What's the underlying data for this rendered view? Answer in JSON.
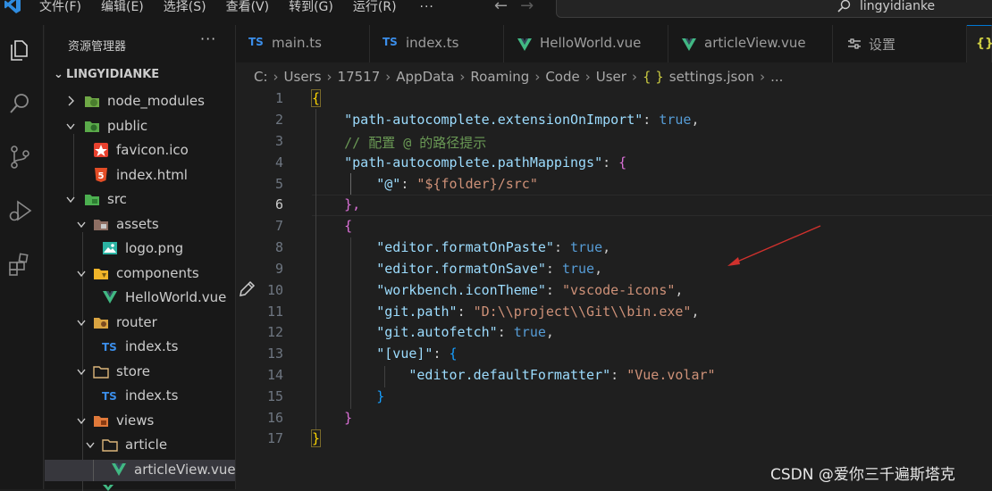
{
  "menu": [
    "文件(F)",
    "编辑(E)",
    "选择(S)",
    "查看(V)",
    "转到(G)",
    "运行(R)"
  ],
  "menu_more": "···",
  "search_text": "lingyidianke",
  "sidebar": {
    "title": "资源管理器",
    "more": "···",
    "project": "LINGYIDIANKE",
    "tree": [
      {
        "label": "node_modules"
      },
      {
        "label": "public"
      },
      {
        "label": "favicon.ico"
      },
      {
        "label": "index.html"
      },
      {
        "label": "src"
      },
      {
        "label": "assets"
      },
      {
        "label": "logo.png"
      },
      {
        "label": "components"
      },
      {
        "label": "HelloWorld.vue"
      },
      {
        "label": "router"
      },
      {
        "label": "index.ts"
      },
      {
        "label": "store"
      },
      {
        "label": "index.ts"
      },
      {
        "label": "views"
      },
      {
        "label": "article"
      },
      {
        "label": "articleView.vue"
      }
    ]
  },
  "tabs": [
    {
      "icon": "TS",
      "label": "main.ts"
    },
    {
      "icon": "TS",
      "label": "index.ts"
    },
    {
      "icon": "",
      "label": "HelloWorld.vue"
    },
    {
      "icon": "",
      "label": "articleView.vue"
    },
    {
      "icon": "",
      "label": "设置"
    },
    {
      "icon": "{}",
      "label": ""
    }
  ],
  "breadcrumb": [
    "C:",
    "Users",
    "17517",
    "AppData",
    "Roaming",
    "Code",
    "User",
    "settings.json",
    "..."
  ],
  "breadcrumb_json_icon": "{ }",
  "editor": {
    "line_numbers": [
      "1",
      "2",
      "3",
      "4",
      "5",
      "6",
      "7",
      "8",
      "9",
      "10",
      "11",
      "12",
      "13",
      "14",
      "15",
      "16",
      "17"
    ],
    "current_line": "6",
    "lines": {
      "l1": "{",
      "l2k": "\"path-autocomplete.extensionOnImport\"",
      "l2v": "true",
      "l3": "// 配置 @ 的路径提示",
      "l4k": "\"path-autocomplete.pathMappings\"",
      "l5k": "\"@\"",
      "l5v": "\"${folder}/src\"",
      "l6": "},",
      "l7": "{",
      "l8k": "\"editor.formatOnPaste\"",
      "l8v": "true",
      "l9k": "\"editor.formatOnSave\"",
      "l9v": "true",
      "l10k": "\"workbench.iconTheme\"",
      "l10v": "\"vscode-icons\"",
      "l11k": "\"git.path\"",
      "l11v": "\"D:\\\\project\\\\Git\\\\bin.exe\"",
      "l12k": "\"git.autofetch\"",
      "l12v": "true",
      "l13k": "\"[vue]\"",
      "l14k": "\"editor.defaultFormatter\"",
      "l14v": "\"Vue.volar\"",
      "l15": "}",
      "l16": "}",
      "l17": "}"
    }
  },
  "watermark": "CSDN @爱你三千遍斯塔克",
  "colors": {
    "accent": "#0078d4",
    "key": "#9cdcfe",
    "string": "#ce9178",
    "bool": "#569cd6",
    "comment": "#6a9955",
    "arrow": "#d0312d"
  }
}
